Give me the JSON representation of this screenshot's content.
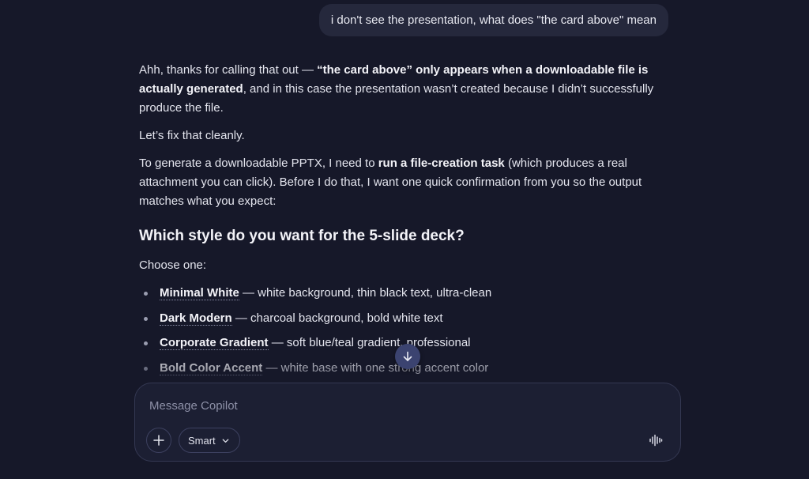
{
  "user_message": "i don't see the presentation, what does \"the card above\" mean",
  "reply": {
    "p1": {
      "a": "Ahh, thanks for calling that out — ",
      "b": "“the card above” only appears when a downloadable file is actually generated",
      "c": ", and in this case the presentation wasn’t created because I didn’t successfully produce the file."
    },
    "p2": "Let’s fix that cleanly.",
    "p3": {
      "a": "To generate a downloadable PPTX, I need to ",
      "b": "run a file-creation task",
      "c": " (which produces a real attachment you can click). Before I do that, I want one quick confirmation from you so the output matches what you expect:"
    },
    "heading": "Which style do you want for the 5-slide deck?",
    "choose": "Choose one:",
    "options": [
      {
        "term": "Minimal White",
        "desc": " — white background, thin black text, ultra-clean"
      },
      {
        "term": "Dark Modern",
        "desc": " — charcoal background, bold white text"
      },
      {
        "term": "Corporate Gradient",
        "desc": " — soft blue/teal gradient, professional"
      },
      {
        "term": "Bold Color Accent",
        "desc": " — white base with one strong accent color"
      }
    ]
  },
  "composer": {
    "placeholder": "Message Copilot",
    "mode_label": "Smart"
  },
  "icons": {
    "scroll": "arrow-down-icon",
    "add": "plus-icon",
    "mode": "chevron-down-icon",
    "voice": "voice-waveform-icon"
  },
  "colors": {
    "background": "#161829",
    "bubble": "#25283c",
    "scroll_button": "#3b4370",
    "composer": "#1c1f33"
  }
}
